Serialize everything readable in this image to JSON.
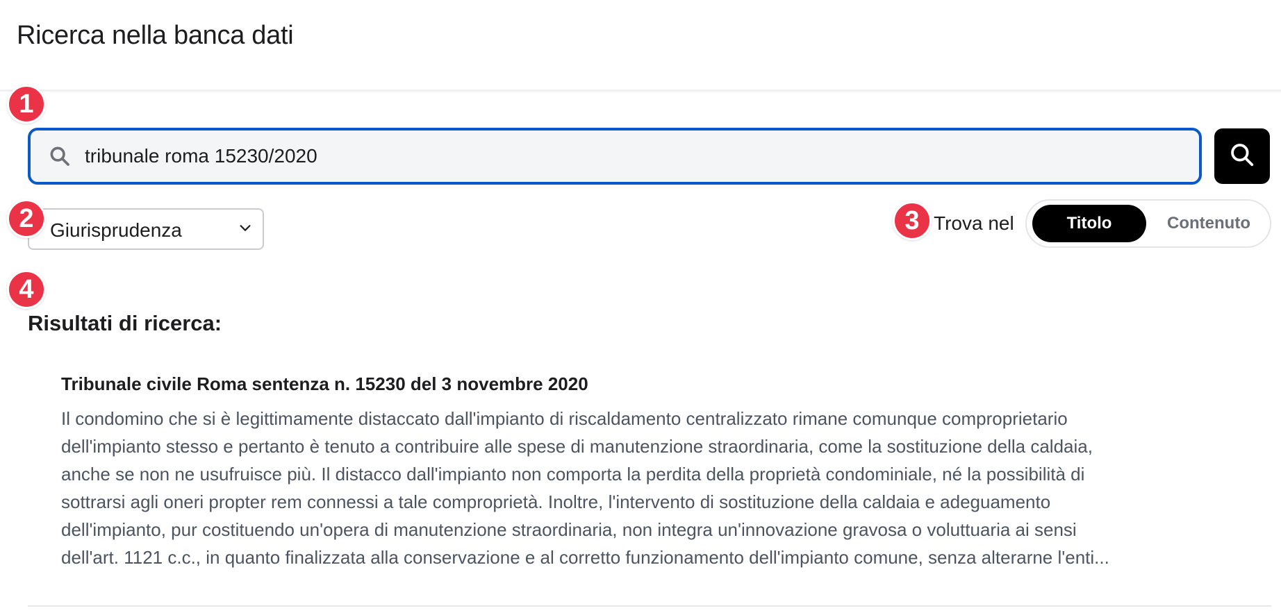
{
  "header": {
    "title": "Ricerca nella banca dati"
  },
  "search": {
    "value": "tribunale roma 15230/2020",
    "lead_icon": "search-icon",
    "button_icon": "search-icon"
  },
  "filters": {
    "category_selected": "Giurisprudenza",
    "find_in_label": "Trova nel",
    "find_in_options": [
      "Titolo",
      "Contenuto"
    ],
    "find_in_active": "Titolo"
  },
  "badges": [
    "1",
    "2",
    "3",
    "4"
  ],
  "results": {
    "heading": "Risultati di ricerca:",
    "items": [
      {
        "title": "Tribunale civile Roma sentenza n. 15230 del 3 novembre 2020",
        "snippet": "Il condomino che si è legittimamente distaccato dall'impianto di riscaldamento centralizzato rimane comunque comproprietario\ndell'impianto stesso e pertanto è tenuto a contribuire alle spese di manutenzione straordinaria, come la sostituzione della caldaia,\nanche se non ne usufruisce più. Il distacco dall'impianto non comporta la perdita della proprietà condominiale, né la possibilità di\nsottrarsi agli oneri propter rem connessi a tale comproprietà. Inoltre, l'intervento di sostituzione della caldaia e adeguamento\ndell'impianto, pur costituendo un'opera di manutenzione straordinaria, non integra un'innovazione gravosa o voluttuaria ai sensi\ndell'art. 1121 c.c., in quanto finalizzata alla conservazione e al corretto funzionamento dell'impianto comune, senza alterarne l'enti..."
      }
    ]
  },
  "colors": {
    "accent_border": "#0b58c9",
    "badge": "#eb3347",
    "toggle_active_bg": "#000000",
    "snippet_text": "#4d5461"
  }
}
